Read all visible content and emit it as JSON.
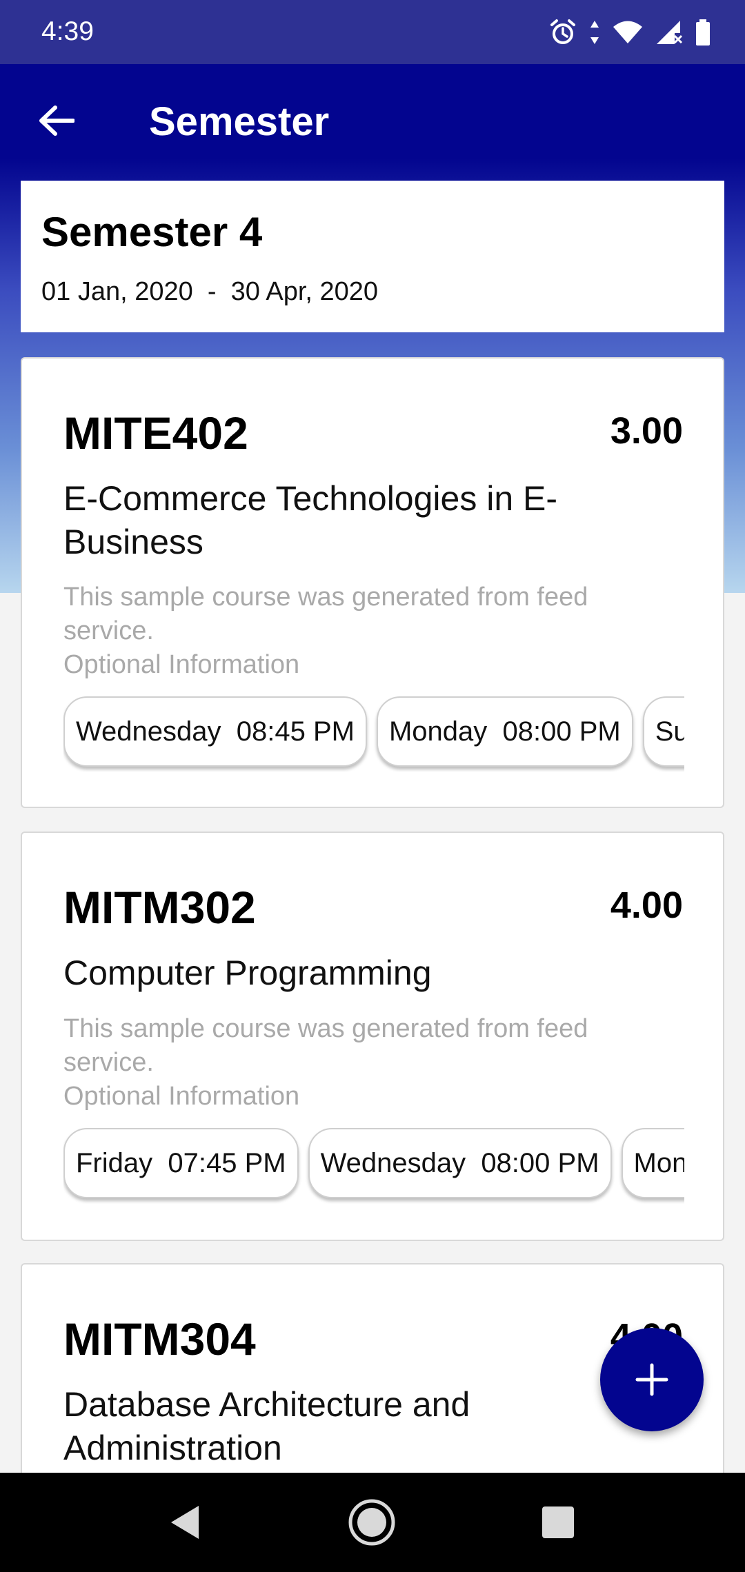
{
  "status_bar": {
    "time": "4:39",
    "icons": [
      "alarm-icon",
      "data-arrows-icon",
      "wifi-icon",
      "signal-icon",
      "battery-icon"
    ]
  },
  "toolbar": {
    "title": "Semester"
  },
  "semester": {
    "title": "Semester 4",
    "dates": "01 Jan, 2020  -  30 Apr, 2020"
  },
  "courses": [
    {
      "code": "MITE402",
      "credits": "3.00",
      "name": "E-Commerce Technologies in E-Business",
      "description": "This sample course was generated from feed service.",
      "optional": "Optional Information",
      "schedule": [
        "Wednesday  08:45 PM",
        "Monday  08:00 PM",
        "Sunday"
      ]
    },
    {
      "code": "MITM302",
      "credits": "4.00",
      "name": "Computer Programming",
      "description": "This sample course was generated from feed service.",
      "optional": "Optional Information",
      "schedule": [
        "Friday  07:45 PM",
        "Wednesday  08:00 PM",
        "Monday"
      ]
    },
    {
      "code": "MITM304",
      "credits": "4.00",
      "name": "Database Architecture and Administration"
    }
  ],
  "colors": {
    "primary": "#03058F",
    "status_bar": "#2E3193",
    "background": "#F3F3F3"
  },
  "fab_icon": "plus-icon",
  "nav_icons": [
    "back-triangle-icon",
    "home-circle-icon",
    "recents-square-icon"
  ]
}
